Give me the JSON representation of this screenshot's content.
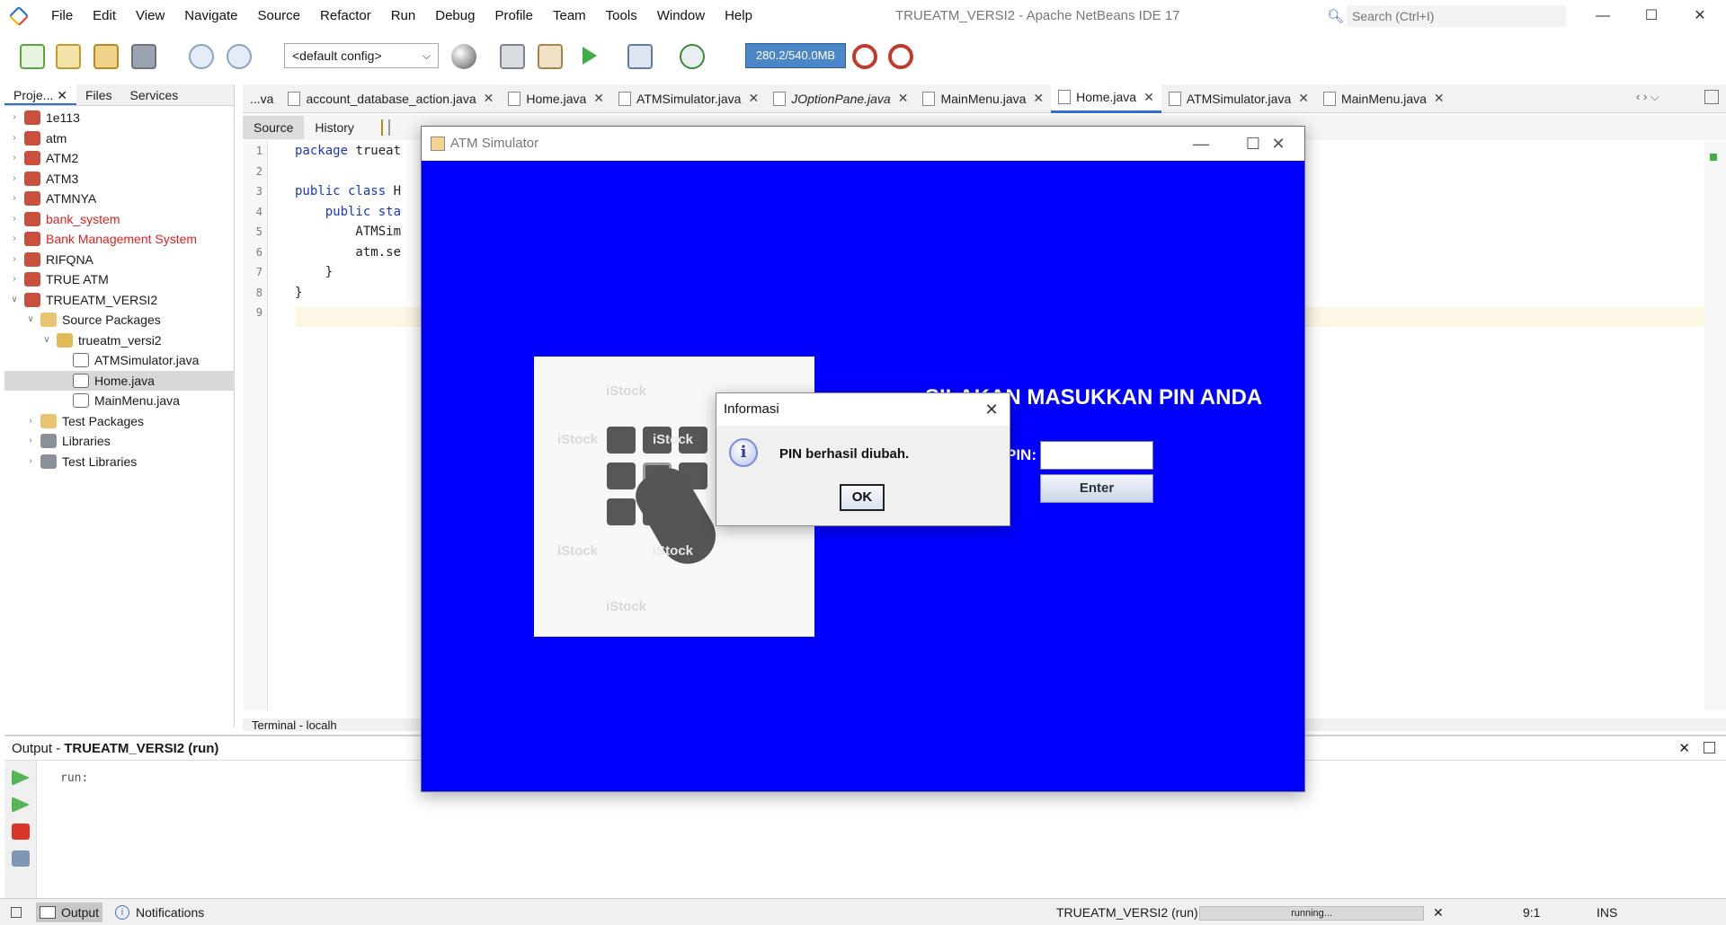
{
  "app": {
    "title": "TRUEATM_VERSI2 - Apache NetBeans IDE 17",
    "menu": [
      "File",
      "Edit",
      "View",
      "Navigate",
      "Source",
      "Refactor",
      "Run",
      "Debug",
      "Profile",
      "Team",
      "Tools",
      "Window",
      "Help"
    ],
    "search_placeholder": "Search (Ctrl+I)",
    "window_controls": {
      "minimize": "—",
      "maximize": "☐",
      "close": "✕"
    }
  },
  "toolbar": {
    "config_value": "<default config>",
    "memory": "280.2/540.0MB"
  },
  "projects_panel": {
    "tabs": [
      "Proje...",
      "Files",
      "Services"
    ],
    "tree": [
      {
        "label": "1e113",
        "level": 0,
        "expanded": false,
        "error": false,
        "icon": "project-icon"
      },
      {
        "label": "atm",
        "level": 0,
        "expanded": false,
        "error": false,
        "icon": "project-icon"
      },
      {
        "label": "ATM2",
        "level": 0,
        "expanded": false,
        "error": false,
        "icon": "project-icon"
      },
      {
        "label": "ATM3",
        "level": 0,
        "expanded": false,
        "error": false,
        "icon": "project-icon"
      },
      {
        "label": "ATMNYA",
        "level": 0,
        "expanded": false,
        "error": false,
        "icon": "project-icon"
      },
      {
        "label": "bank_system",
        "level": 0,
        "expanded": false,
        "error": true,
        "icon": "project-icon"
      },
      {
        "label": "Bank Management System",
        "level": 0,
        "expanded": false,
        "error": true,
        "icon": "project-icon"
      },
      {
        "label": "RIFQNA",
        "level": 0,
        "expanded": false,
        "error": false,
        "icon": "project-icon"
      },
      {
        "label": "TRUE ATM",
        "level": 0,
        "expanded": false,
        "error": false,
        "icon": "project-icon"
      },
      {
        "label": "TRUEATM_VERSI2",
        "level": 0,
        "expanded": true,
        "error": false,
        "icon": "project-icon"
      },
      {
        "label": "Source Packages",
        "level": 1,
        "expanded": true,
        "error": false,
        "icon": "folder-icon"
      },
      {
        "label": "trueatm_versi2",
        "level": 2,
        "expanded": true,
        "error": false,
        "icon": "package-icon"
      },
      {
        "label": "ATMSimulator.java",
        "level": 3,
        "expanded": null,
        "error": false,
        "icon": "java-file-icon"
      },
      {
        "label": "Home.java",
        "level": 3,
        "expanded": null,
        "error": false,
        "icon": "java-file-icon",
        "selected": true
      },
      {
        "label": "MainMenu.java",
        "level": 3,
        "expanded": null,
        "error": false,
        "icon": "java-file-icon"
      },
      {
        "label": "Test Packages",
        "level": 1,
        "expanded": false,
        "error": false,
        "icon": "folder-icon"
      },
      {
        "label": "Libraries",
        "level": 1,
        "expanded": false,
        "error": false,
        "icon": "library-icon"
      },
      {
        "label": "Test Libraries",
        "level": 1,
        "expanded": false,
        "error": false,
        "icon": "library-icon"
      }
    ]
  },
  "editor": {
    "tabs": [
      {
        "label": "...va",
        "active": false,
        "italic": false,
        "closable": false
      },
      {
        "label": "account_database_action.java",
        "active": false,
        "italic": false,
        "closable": true
      },
      {
        "label": "Home.java",
        "active": false,
        "italic": false,
        "closable": true
      },
      {
        "label": "ATMSimulator.java",
        "active": false,
        "italic": false,
        "closable": true
      },
      {
        "label": "JOptionPane.java",
        "active": false,
        "italic": true,
        "closable": true
      },
      {
        "label": "MainMenu.java",
        "active": false,
        "italic": false,
        "closable": true
      },
      {
        "label": "Home.java",
        "active": true,
        "italic": false,
        "closable": true
      },
      {
        "label": "ATMSimulator.java",
        "active": false,
        "italic": false,
        "closable": true
      },
      {
        "label": "MainMenu.java",
        "active": false,
        "italic": false,
        "closable": true
      }
    ],
    "source_label": "Source",
    "history_label": "History",
    "line_numbers": [
      "1",
      "2",
      "3",
      "4",
      "5",
      "6",
      "7",
      "8",
      "9"
    ],
    "code_lines": [
      {
        "kw": "package",
        "rest": " trueat"
      },
      {
        "kw": "",
        "rest": ""
      },
      {
        "kw": "public class",
        "rest": " H"
      },
      {
        "kw": "    public sta",
        "rest": ""
      },
      {
        "kw": "",
        "rest": "        ATMSim"
      },
      {
        "kw": "",
        "rest": "        atm.se"
      },
      {
        "kw": "",
        "rest": "    }"
      },
      {
        "kw": "",
        "rest": "}"
      },
      {
        "kw": "",
        "rest": ""
      }
    ],
    "terminal_tab": "Terminal - localh"
  },
  "output": {
    "title_prefix": "Output - ",
    "title_project": "TRUEATM_VERSI2 (run)",
    "text": "run:"
  },
  "statusbar": {
    "output_tab": "Output",
    "notifications_tab": "Notifications",
    "project": "TRUEATM_VERSI2 (run)",
    "progress_text": "running...",
    "position": "9:1",
    "mode": "INS"
  },
  "atm_window": {
    "title": "ATM Simulator",
    "prompt": "SILAKAN MASUKKAN PIN ANDA",
    "pin_label": "PIN:",
    "enter_label": "Enter",
    "watermark": "iStock",
    "background": "#0000ff"
  },
  "dialog": {
    "title": "Informasi",
    "message": "PIN berhasil diubah.",
    "ok_label": "OK",
    "icon": "info-icon"
  }
}
